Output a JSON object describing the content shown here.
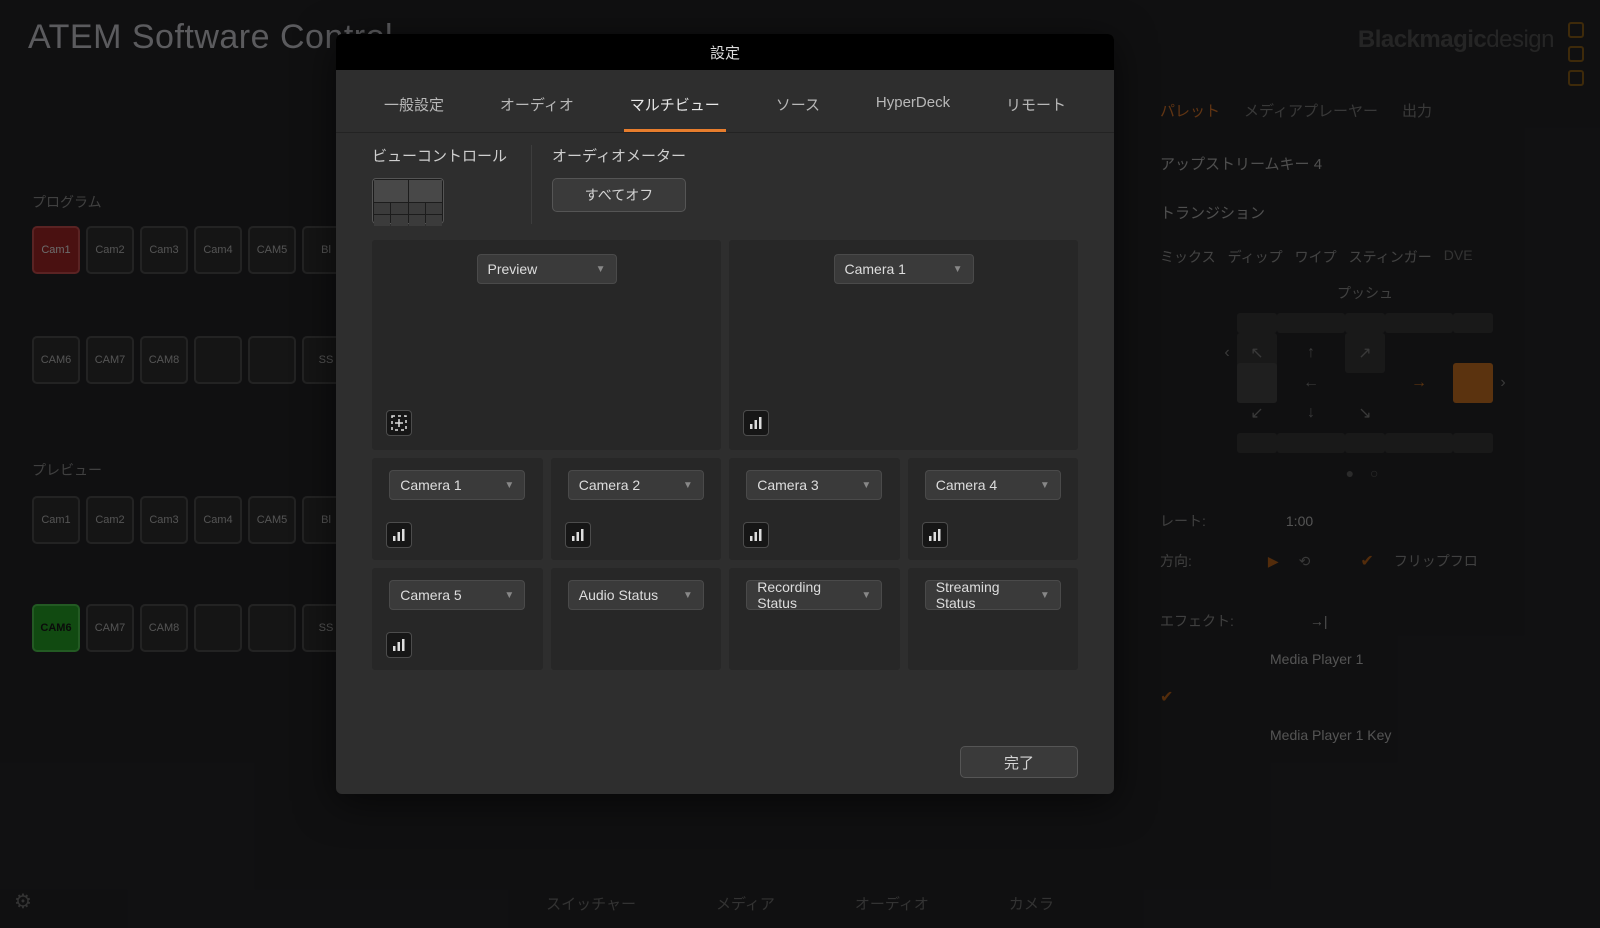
{
  "app": {
    "title": "ATEM Software Control",
    "brand": "Blackmagic",
    "brand_suffix": "design"
  },
  "background": {
    "program_label": "プログラム",
    "preview_label": "プレビュー",
    "program_row1": [
      "Cam1",
      "Cam2",
      "Cam3",
      "Cam4",
      "CAM5",
      "Bl"
    ],
    "program_row2": [
      "CAM6",
      "CAM7",
      "CAM8",
      "",
      "",
      "SS"
    ],
    "preview_row1": [
      "Cam1",
      "Cam2",
      "Cam3",
      "Cam4",
      "CAM5",
      "Bl"
    ],
    "preview_row2": [
      "CAM6",
      "CAM7",
      "CAM8",
      "",
      "",
      "SS"
    ],
    "bottom_tabs": [
      "スイッチャー",
      "メディア",
      "オーディオ",
      "カメラ"
    ]
  },
  "right_panel": {
    "tabs": [
      "パレット",
      "メディアプレーヤー",
      "出力"
    ],
    "upstream_key": "アップストリームキー 4",
    "transition_label": "トランジション",
    "transition_tabs": [
      "ミックス",
      "ディップ",
      "ワイプ",
      "スティンガー",
      "DVE"
    ],
    "push_label": "プッシュ",
    "rate_label": "レート:",
    "rate_value": "1:00",
    "direction_label": "方向:",
    "flipflop_label": "フリップフロ",
    "effect_label": "エフェクト:",
    "rows": [
      {
        "label": "",
        "value": "Media Player 1"
      },
      {
        "label": "",
        "value": ""
      },
      {
        "label": "",
        "value": "Media Player 1 Key"
      }
    ]
  },
  "modal": {
    "title": "設定",
    "tabs": [
      "一般設定",
      "オーディオ",
      "マルチビュー",
      "ソース",
      "HyperDeck",
      "リモート"
    ],
    "active_tab_index": 2,
    "view_control_label": "ビューコントロール",
    "audio_meter_label": "オーディオメーター",
    "all_off_label": "すべてオフ",
    "done_label": "完了",
    "large_cells": [
      {
        "name": "Preview",
        "icon": "safe-area"
      },
      {
        "name": "Camera 1",
        "icon": "vu"
      }
    ],
    "small_cells_row1": [
      {
        "name": "Camera 1",
        "icon": "vu"
      },
      {
        "name": "Camera 2",
        "icon": "vu"
      },
      {
        "name": "Camera 3",
        "icon": "vu"
      },
      {
        "name": "Camera 4",
        "icon": "vu"
      }
    ],
    "small_cells_row2": [
      {
        "name": "Camera 5",
        "icon": "vu"
      },
      {
        "name": "Audio Status",
        "icon": null
      },
      {
        "name": "Recording Status",
        "icon": null
      },
      {
        "name": "Streaming Status",
        "icon": null
      }
    ]
  }
}
